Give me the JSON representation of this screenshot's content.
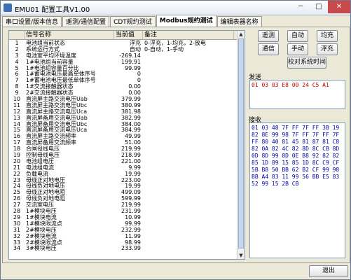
{
  "window": {
    "title": "EMU01 配置工具V1.00"
  },
  "tabs": [
    "串口设置/版本信息",
    "遥测/通信配置",
    "CDT规约测试",
    "Modbus规约测试",
    "编辑表器名称"
  ],
  "active_tab": 3,
  "table": {
    "headers": [
      "",
      "信号名称",
      "当前值",
      "备注"
    ],
    "rows": [
      [
        "1",
        "电池组当前状态",
        "浮充",
        "0-浮充，1-均充，2-放电"
      ],
      [
        "2",
        "系统运行方式",
        "自动",
        "0-自动，1-手动"
      ],
      [
        "3",
        "电池室平均环境温度",
        "-269.14",
        ""
      ],
      [
        "4",
        "1#电池组当前容量",
        "199.91",
        ""
      ],
      [
        "5",
        "1#电池组容量百分比",
        "99.99",
        ""
      ],
      [
        "6",
        "1#蓄电池电压最高单体序号",
        "0",
        ""
      ],
      [
        "7",
        "1#蓄电池电压最低单体序号",
        "0",
        ""
      ],
      [
        "8",
        "1#交流接触器状态",
        "0.00",
        ""
      ],
      [
        "9",
        "2#交流接触器状态",
        "0.00",
        ""
      ],
      [
        "10",
        "直流屏主路交流电压Uab",
        "379.99",
        ""
      ],
      [
        "11",
        "直流屏主路交流电压Ubc",
        "380.99",
        ""
      ],
      [
        "12",
        "直流屏主路交流电压Uca",
        "381.98",
        ""
      ],
      [
        "13",
        "直流屏备用交流电压Uab",
        "382.99",
        ""
      ],
      [
        "14",
        "直流屏备用交流电压Ubc",
        "384.00",
        ""
      ],
      [
        "15",
        "直流屏备用交流电压Uca",
        "384.99",
        ""
      ],
      [
        "16",
        "直流屏主路交流频率",
        "49.99",
        ""
      ],
      [
        "17",
        "直流屏备用交流频率",
        "51.00",
        ""
      ],
      [
        "18",
        "合闸母线电压",
        "219.99",
        ""
      ],
      [
        "19",
        "控制母线电压",
        "218.99",
        ""
      ],
      [
        "20",
        "电池组电压",
        "221.00",
        ""
      ],
      [
        "21",
        "电池组电流",
        "9.99",
        ""
      ],
      [
        "22",
        "负载电流",
        "19.99",
        ""
      ],
      [
        "23",
        "母线正对地电压",
        "223.00",
        ""
      ],
      [
        "24",
        "母线负对地电压",
        "19.99",
        ""
      ],
      [
        "25",
        "母线正对地电阻",
        "499.09",
        ""
      ],
      [
        "26",
        "母线负对地电阻",
        "599.99",
        ""
      ],
      [
        "27",
        "交流室电压",
        "219.99",
        ""
      ],
      [
        "28",
        "1#模块电压",
        "231.99",
        ""
      ],
      [
        "29",
        "1#模块电流",
        "10.99",
        ""
      ],
      [
        "30",
        "1#模块限流点",
        "99.99",
        ""
      ],
      [
        "31",
        "2#模块电压",
        "232.99",
        ""
      ],
      [
        "32",
        "2#模块电流",
        "11.99",
        ""
      ],
      [
        "33",
        "2#模块限流点",
        "98.99",
        ""
      ],
      [
        "34",
        "3#模块电压",
        "233.99",
        ""
      ]
    ]
  },
  "buttons": {
    "telemetry": "遥测",
    "auto": "自动",
    "equalize": "均充",
    "comm": "通信",
    "manual": "手动",
    "float": "浮充",
    "sync_time": "校对系统时间",
    "exit": "退出"
  },
  "send": {
    "label": "发送",
    "content": "01 03 03 E8 00 24 C5 A1"
  },
  "receive": {
    "label": "接收",
    "content": "01 03 48 7F FF 7F FF 3B 19 82 8E 99 98 7F FF 7F FF 7F FF 80 40 81 45 81 87 81 C8 82 0A 82 4C 82 8D 8C CB 8D 0D 8D 99 8D 0E B8 92 82 82 85 1D 89 15 85 1D 8C C9 CF 5B B8 50 BB 62 B2 CF 99 98 BB A4 83 11 99 56 BB E5 83 52 99 15 2B CB"
  }
}
